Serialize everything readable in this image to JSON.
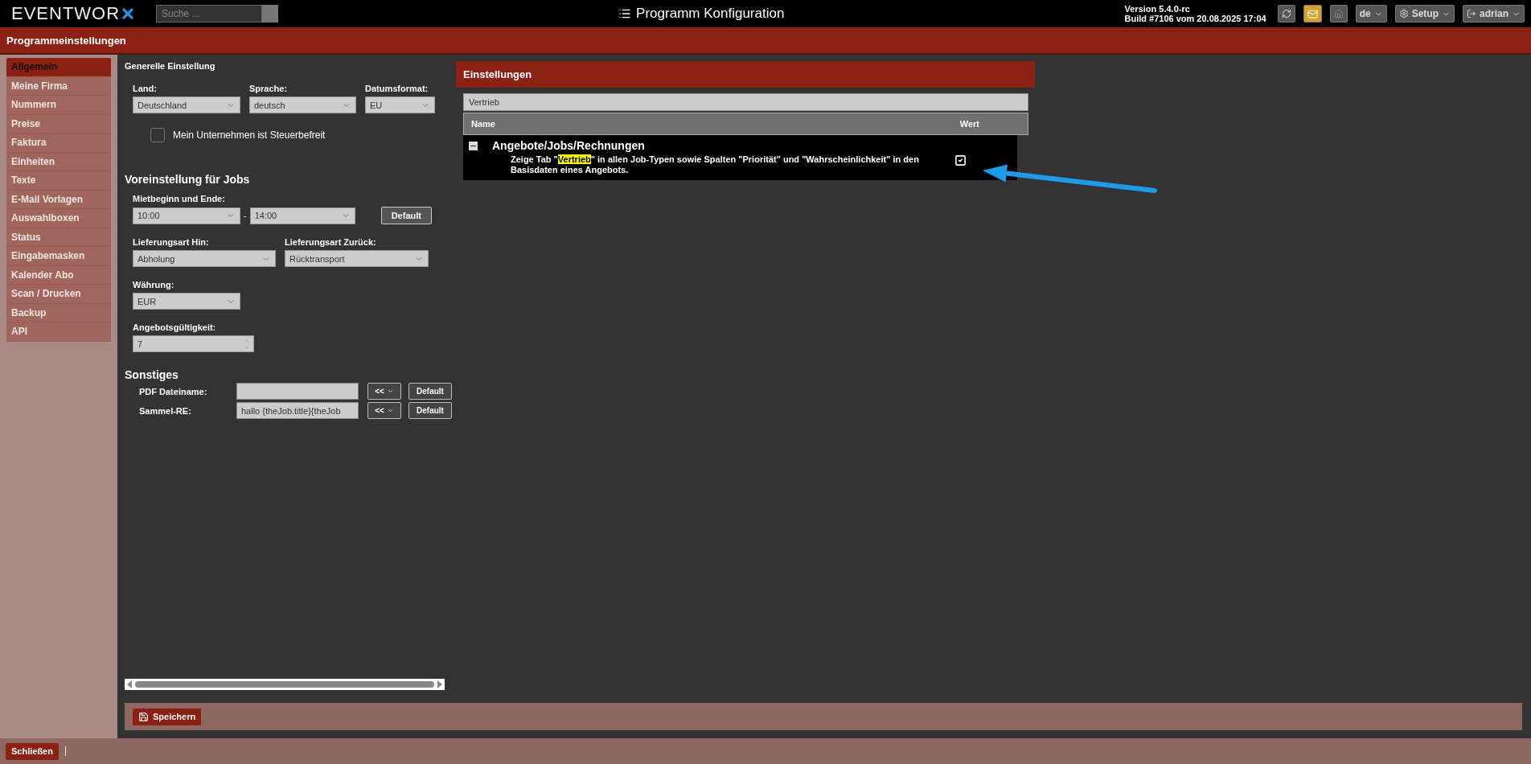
{
  "topbar": {
    "logo": "EVENTWOR",
    "search": {
      "placeholder": "Suche ..."
    },
    "title": "Programm Konfiguration",
    "version": "Version 5.4.0-rc",
    "build": "Build #7106 vom 20.08.2025 17:04",
    "language": "de",
    "setup": "Setup",
    "user": "adrian"
  },
  "page_title": "Programmeinstellungen",
  "sidebar": {
    "items": [
      {
        "label": "Allgemein",
        "selected": true
      },
      {
        "label": "Meine Firma",
        "selected": false
      },
      {
        "label": "Nummern",
        "selected": false
      },
      {
        "label": "Preise",
        "selected": false
      },
      {
        "label": "Faktura",
        "selected": false
      },
      {
        "label": "Einheiten",
        "selected": false
      },
      {
        "label": "Texte",
        "selected": false
      },
      {
        "label": "E-Mail Vorlagen",
        "selected": false
      },
      {
        "label": "Auswahlboxen",
        "selected": false
      },
      {
        "label": "Status",
        "selected": false
      },
      {
        "label": "Eingabemasken",
        "selected": false
      },
      {
        "label": "Kalender Abo",
        "selected": false
      },
      {
        "label": "Scan / Drucken",
        "selected": false
      },
      {
        "label": "Backup",
        "selected": false
      },
      {
        "label": "API",
        "selected": false
      }
    ]
  },
  "general": {
    "title": "Generelle Einstellung",
    "fields": [
      {
        "label": "Land:",
        "value": "Deutschland"
      },
      {
        "label": "Sprache:",
        "value": "deutsch"
      },
      {
        "label": "Datumsformat:",
        "value": "EU"
      }
    ],
    "tax_free": {
      "label": "Mein Unternehmen ist Steuerbefreit",
      "checked": false
    }
  },
  "jobs": {
    "title": "Voreinstellung für Jobs",
    "rent_label": "Mietbeginn und Ende:",
    "rent_start": "10:00",
    "separator": "-",
    "rent_end": "14:00",
    "default_button": "Default",
    "delivery": [
      {
        "label": "Lieferungsart Hin:",
        "value": "Abholung"
      },
      {
        "label": "Lieferungsart Zurück:",
        "value": "Rücktransport"
      }
    ],
    "currency": {
      "label": "Währung:",
      "value": "EUR"
    },
    "validity": {
      "label": "Angebotsgültigkeit:",
      "value": "7"
    }
  },
  "misc": {
    "title": "Sonstiges",
    "rows": [
      {
        "label": "PDF Dateiname:",
        "value": "",
        "insert": "<<",
        "default": "Default"
      },
      {
        "label": "Sammel-RE:",
        "value": "hallo {theJob.title}{theJob",
        "insert": "<<",
        "default": "Default"
      }
    ]
  },
  "settings": {
    "title": "Einstellungen",
    "filter": "Vertrieb",
    "columns": [
      "Name",
      "Wert"
    ],
    "groups": [
      {
        "name": "Angebote/Jobs/Rechnungen",
        "expanded": true,
        "items": [
          {
            "text_before": "Zeige Tab \"",
            "highlight": "Vertrieb",
            "text_after": "\" in allen Job-Typen sowie Spalten \"Priorität\" und \"Wahrscheinlichkeit\" in den Basisdaten eines Angebots.",
            "checked": true
          }
        ]
      }
    ]
  },
  "save_button": "Speichern",
  "close_button": "Schließen"
}
